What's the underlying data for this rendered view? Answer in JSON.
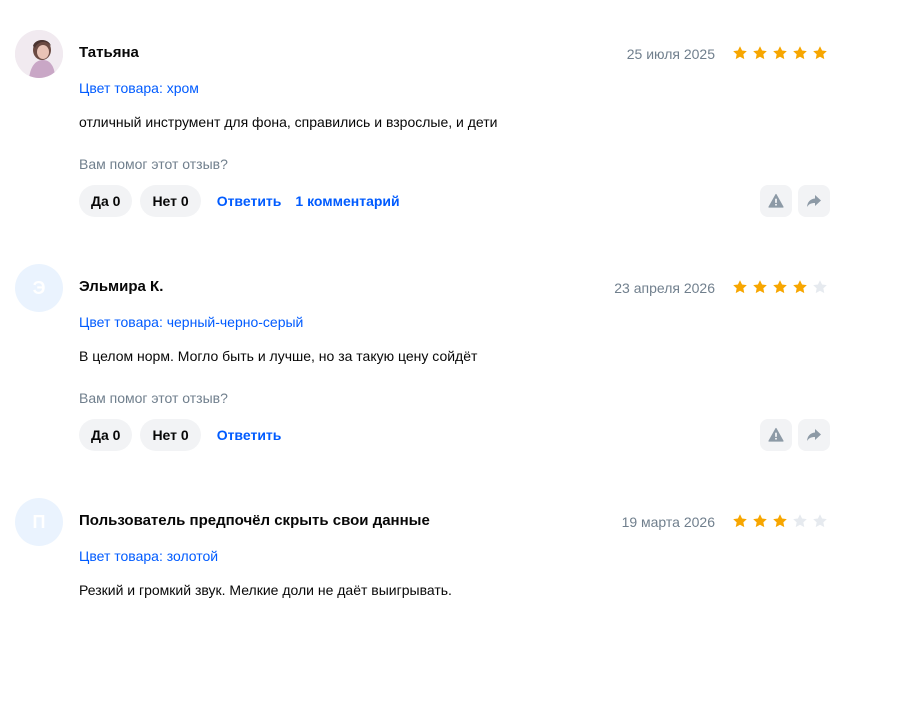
{
  "reviews": [
    {
      "author": "Татьяна",
      "avatar_letter": "",
      "has_photo": true,
      "date": "25 июля 2025",
      "rating": 5,
      "color": "Цвет товара: хром",
      "text": "отличный инструмент для фона, справились и взрослые, и дети",
      "helpful_prompt": "Вам помог этот отзыв?",
      "yes_label": "Да 0",
      "no_label": "Нет 0",
      "reply_label": "Ответить",
      "comments_label": "1 комментарий"
    },
    {
      "author": "Эльмира К.",
      "avatar_letter": "Э",
      "has_photo": false,
      "date": "23 апреля 2026",
      "rating": 4,
      "color": "Цвет товара: черный-черно-серый",
      "text": "В целом норм. Могло быть и лучше, но за такую цену сойдёт",
      "helpful_prompt": "Вам помог этот отзыв?",
      "yes_label": "Да 0",
      "no_label": "Нет 0",
      "reply_label": "Ответить"
    },
    {
      "author": "Пользователь предпочёл скрыть свои данные",
      "avatar_letter": "П",
      "has_photo": false,
      "date": "19 марта 2026",
      "rating": 3,
      "color": "Цвет товара: золотой",
      "text": "Резкий и громкий звук. Мелкие доли не даёт выигрывать."
    }
  ],
  "icons": {
    "report": "warning-icon",
    "share": "share-arrow-icon"
  },
  "colors": {
    "star_filled": "#f7a600",
    "star_empty": "#e6eaef",
    "link": "#005bff",
    "muted": "#707f8d",
    "pill_bg": "#f2f3f5",
    "avatar_bg": "#eaf3fe"
  }
}
